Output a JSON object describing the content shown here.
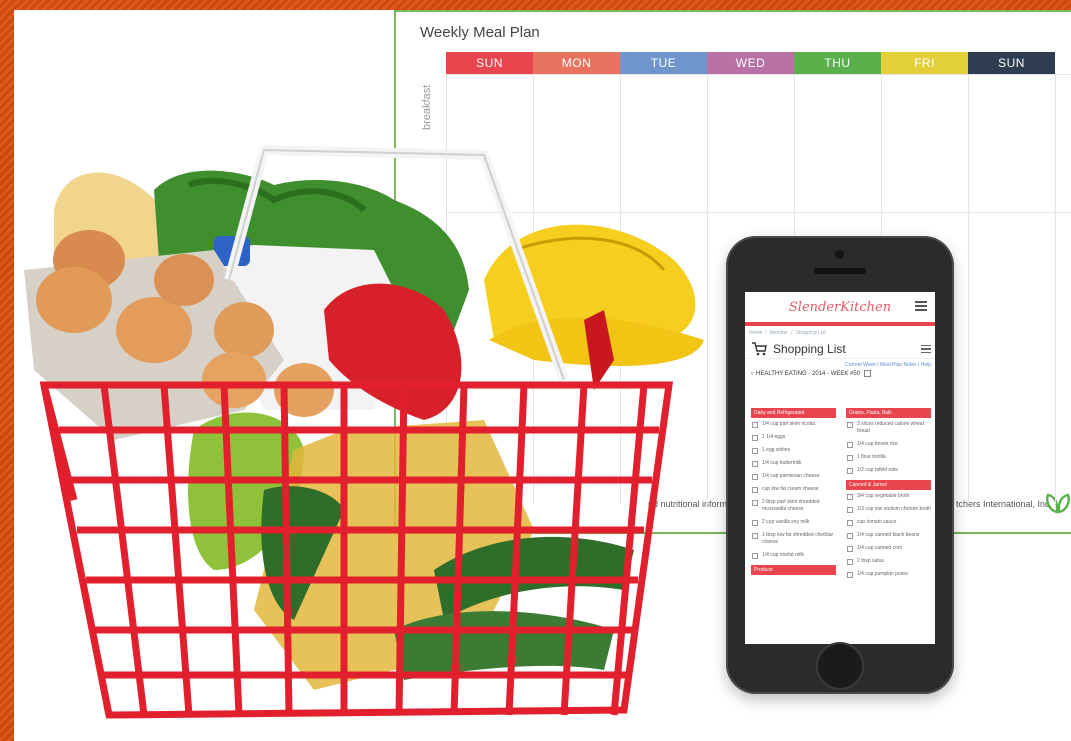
{
  "planner": {
    "title": "Weekly Meal Plan",
    "days": [
      {
        "label": "SUN",
        "color": "#e8454e"
      },
      {
        "label": "MON",
        "color": "#e8735e"
      },
      {
        "label": "TUE",
        "color": "#6f95cc"
      },
      {
        "label": "WED",
        "color": "#b972a6"
      },
      {
        "label": "THU",
        "color": "#5aaf4a"
      },
      {
        "label": "FRI",
        "color": "#e3cf3a"
      },
      {
        "label": "SUN",
        "color": "#2e3d52"
      }
    ],
    "meal_label": "breakfast",
    "footer_left": "nd nutritional informati",
    "footer_right": "tchers International, Inc."
  },
  "phone_screen": {
    "logo": "SlenderKitchen",
    "breadcrumb": [
      "Home",
      "/",
      "Member",
      "/",
      "Shopping List"
    ],
    "title": "Shopping List",
    "links": "Current Week | Meal Plan Notes | Help",
    "week": "HEALTHY EATING - 2014 - WEEK #50",
    "columns": [
      {
        "sections": [
          {
            "name": "Dairy and Refrigerated",
            "items": [
              "1/4 cup part skim ricotta",
              "1 1/4 eggs",
              "1 egg whites",
              "1/4 cup buttermilk",
              "1/4 cup parmesan cheese",
              "cup low fat cream cheese",
              "2 tbsp part skim shredded mozzarella cheese",
              "2 cup vanilla soy milk",
              "1 tbsp low fat shredded cheddar cheese",
              "1/4 cup nonfat milk"
            ]
          },
          {
            "name": "Produce",
            "items": []
          }
        ]
      },
      {
        "sections": [
          {
            "name": "Grains, Pasta, Bulk",
            "items": [
              "3 slices reduced calorie wheat bread",
              "1/4 cup brown rice",
              "1 flour tortilla",
              "1/2 cup rolled oats"
            ]
          },
          {
            "name": "Canned & Jarred",
            "items": [
              "3/4 cup vegetable broth",
              "1/3 cup low sodium chicken broth",
              "cup tomato sauce",
              "1/4 cup canned black beans",
              "1/4 cup canned corn",
              "2 tbsp salsa",
              "1/4 cup pumpkin puree"
            ]
          }
        ]
      }
    ]
  },
  "colors": {
    "accent": "#e8454e",
    "frame": "#d9530f",
    "planner_border": "#7ab85a"
  }
}
